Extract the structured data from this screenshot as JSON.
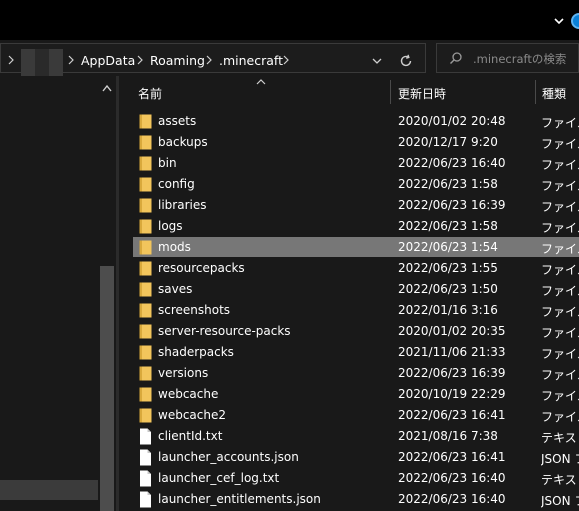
{
  "address": {
    "crumbs": [
      "AppData",
      "Roaming",
      ".minecraft"
    ]
  },
  "search": {
    "placeholder": ".minecraftの検索"
  },
  "columns": {
    "name": "名前",
    "date": "更新日時",
    "type": "種類"
  },
  "files": [
    {
      "name": "assets",
      "date": "2020/01/02 20:48",
      "type": "ファイル",
      "kind": "folder"
    },
    {
      "name": "backups",
      "date": "2020/12/17 9:20",
      "type": "ファイル",
      "kind": "folder"
    },
    {
      "name": "bin",
      "date": "2022/06/23 16:40",
      "type": "ファイル",
      "kind": "folder"
    },
    {
      "name": "config",
      "date": "2022/06/23 1:58",
      "type": "ファイル",
      "kind": "folder"
    },
    {
      "name": "libraries",
      "date": "2022/06/23 16:39",
      "type": "ファイル",
      "kind": "folder"
    },
    {
      "name": "logs",
      "date": "2022/06/23 1:58",
      "type": "ファイル",
      "kind": "folder"
    },
    {
      "name": "mods",
      "date": "2022/06/23 1:54",
      "type": "ファイル",
      "kind": "folder",
      "selected": true
    },
    {
      "name": "resourcepacks",
      "date": "2022/06/23 1:55",
      "type": "ファイル",
      "kind": "folder"
    },
    {
      "name": "saves",
      "date": "2022/06/23 1:50",
      "type": "ファイル",
      "kind": "folder"
    },
    {
      "name": "screenshots",
      "date": "2022/01/16 3:16",
      "type": "ファイル",
      "kind": "folder"
    },
    {
      "name": "server-resource-packs",
      "date": "2020/01/02 20:35",
      "type": "ファイル",
      "kind": "folder"
    },
    {
      "name": "shaderpacks",
      "date": "2021/11/06 21:33",
      "type": "ファイル",
      "kind": "folder"
    },
    {
      "name": "versions",
      "date": "2022/06/23 16:39",
      "type": "ファイル",
      "kind": "folder"
    },
    {
      "name": "webcache",
      "date": "2020/10/19 22:29",
      "type": "ファイル",
      "kind": "folder"
    },
    {
      "name": "webcache2",
      "date": "2022/06/23 16:41",
      "type": "ファイル",
      "kind": "folder"
    },
    {
      "name": "clientId.txt",
      "date": "2021/08/16 7:38",
      "type": "テキスト",
      "kind": "file"
    },
    {
      "name": "launcher_accounts.json",
      "date": "2022/06/23 16:41",
      "type": "JSON フ",
      "kind": "file"
    },
    {
      "name": "launcher_cef_log.txt",
      "date": "2022/06/23 16:40",
      "type": "テキスト",
      "kind": "file"
    },
    {
      "name": "launcher_entitlements.json",
      "date": "2022/06/23 16:40",
      "type": "JSON フ",
      "kind": "file"
    }
  ],
  "icons": {
    "folder": "folder-icon",
    "file": "file-icon"
  },
  "colors": {
    "folder": "#f2c55c",
    "selection": "#777777",
    "accent": "#0a7fd6"
  }
}
